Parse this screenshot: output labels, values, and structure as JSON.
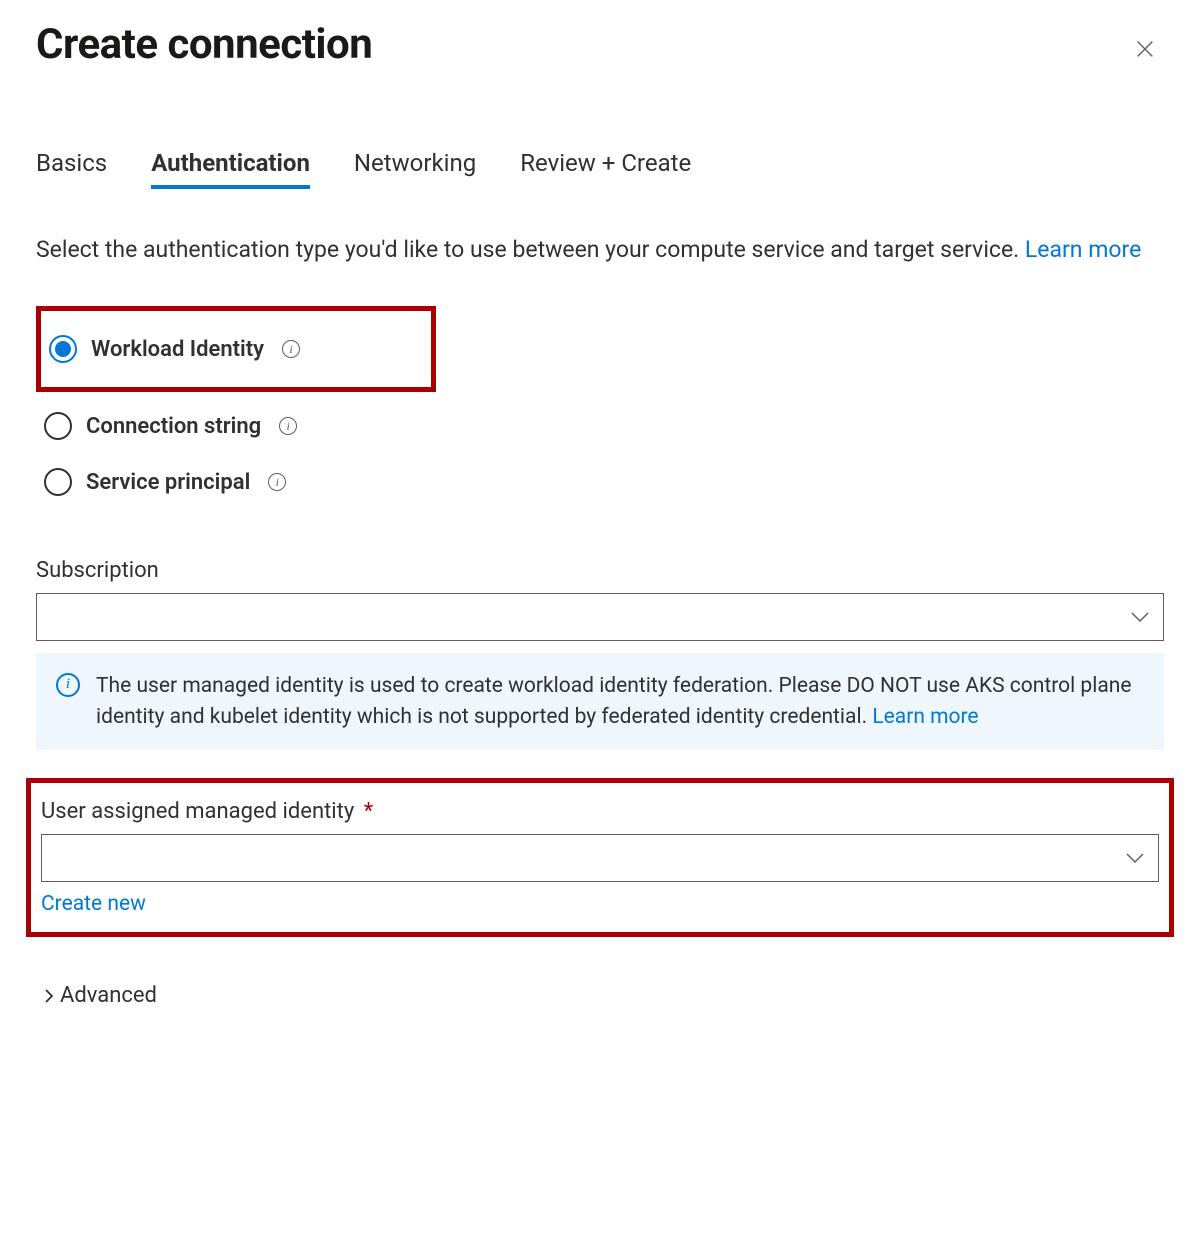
{
  "header": {
    "title": "Create connection"
  },
  "tabs": [
    {
      "label": "Basics",
      "active": false
    },
    {
      "label": "Authentication",
      "active": true
    },
    {
      "label": "Networking",
      "active": false
    },
    {
      "label": "Review + Create",
      "active": false
    }
  ],
  "intro": {
    "text": "Select the authentication type you'd like to use between your compute service and target service. ",
    "learn_more": "Learn more"
  },
  "auth_options": [
    {
      "label": "Workload Identity",
      "selected": true
    },
    {
      "label": "Connection string",
      "selected": false
    },
    {
      "label": "Service principal",
      "selected": false
    }
  ],
  "subscription": {
    "label": "Subscription",
    "value": ""
  },
  "banner": {
    "text": "The user managed identity is used to create workload identity federation. Please DO NOT use AKS control plane identity and kubelet identity which is not supported by federated identity credential.  ",
    "learn_more": "Learn more"
  },
  "uami": {
    "label": "User assigned managed identity",
    "required_mark": "*",
    "value": "",
    "create_new": "Create new"
  },
  "advanced": {
    "label": "Advanced"
  },
  "icons": {
    "info_glyph": "i"
  }
}
